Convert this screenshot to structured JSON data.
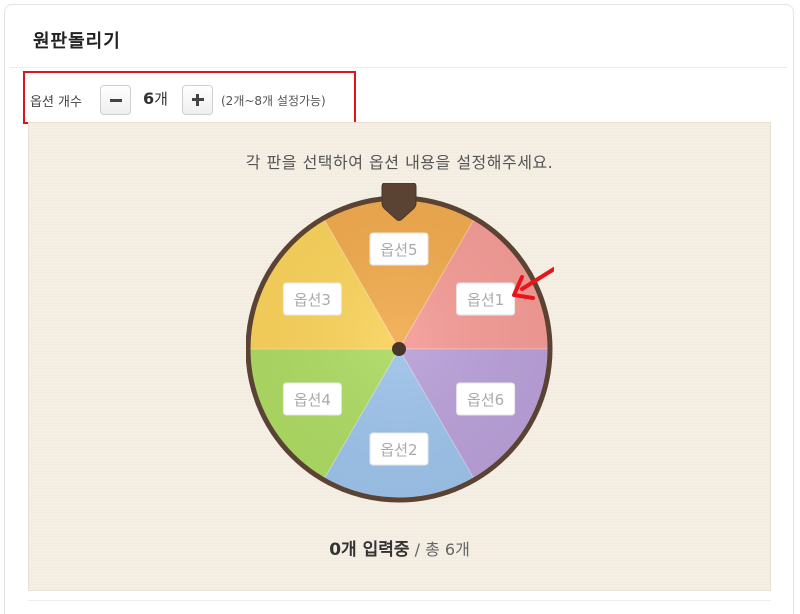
{
  "panel": {
    "title": "원판돌리기"
  },
  "controls": {
    "option_count_label": "옵션 개수",
    "count_value": "6",
    "count_unit": "개",
    "range_hint": "(2개~8개 설정가능)",
    "minus_icon": "minus-icon",
    "plus_icon": "plus-icon"
  },
  "wheel": {
    "instruction": "각 판을 선택하여 옵션 내용을 설정해주세요.",
    "segments": [
      {
        "label": "옵션1",
        "color": "#f49a95"
      },
      {
        "label": "옵션6",
        "color": "#b9a0d8"
      },
      {
        "label": "옵션2",
        "color": "#9dc3ea"
      },
      {
        "label": "옵션4",
        "color": "#addb63"
      },
      {
        "label": "옵션3",
        "color": "#f9d25a"
      },
      {
        "label": "옵션5",
        "color": "#f0a94c"
      }
    ],
    "rim_color": "#5b4334",
    "pointer_color": "#5b4334"
  },
  "status": {
    "entered": "0개 입력중",
    "separator": " / ",
    "total": "총 6개"
  },
  "annotation": {
    "arrow_color": "#e8141b"
  }
}
